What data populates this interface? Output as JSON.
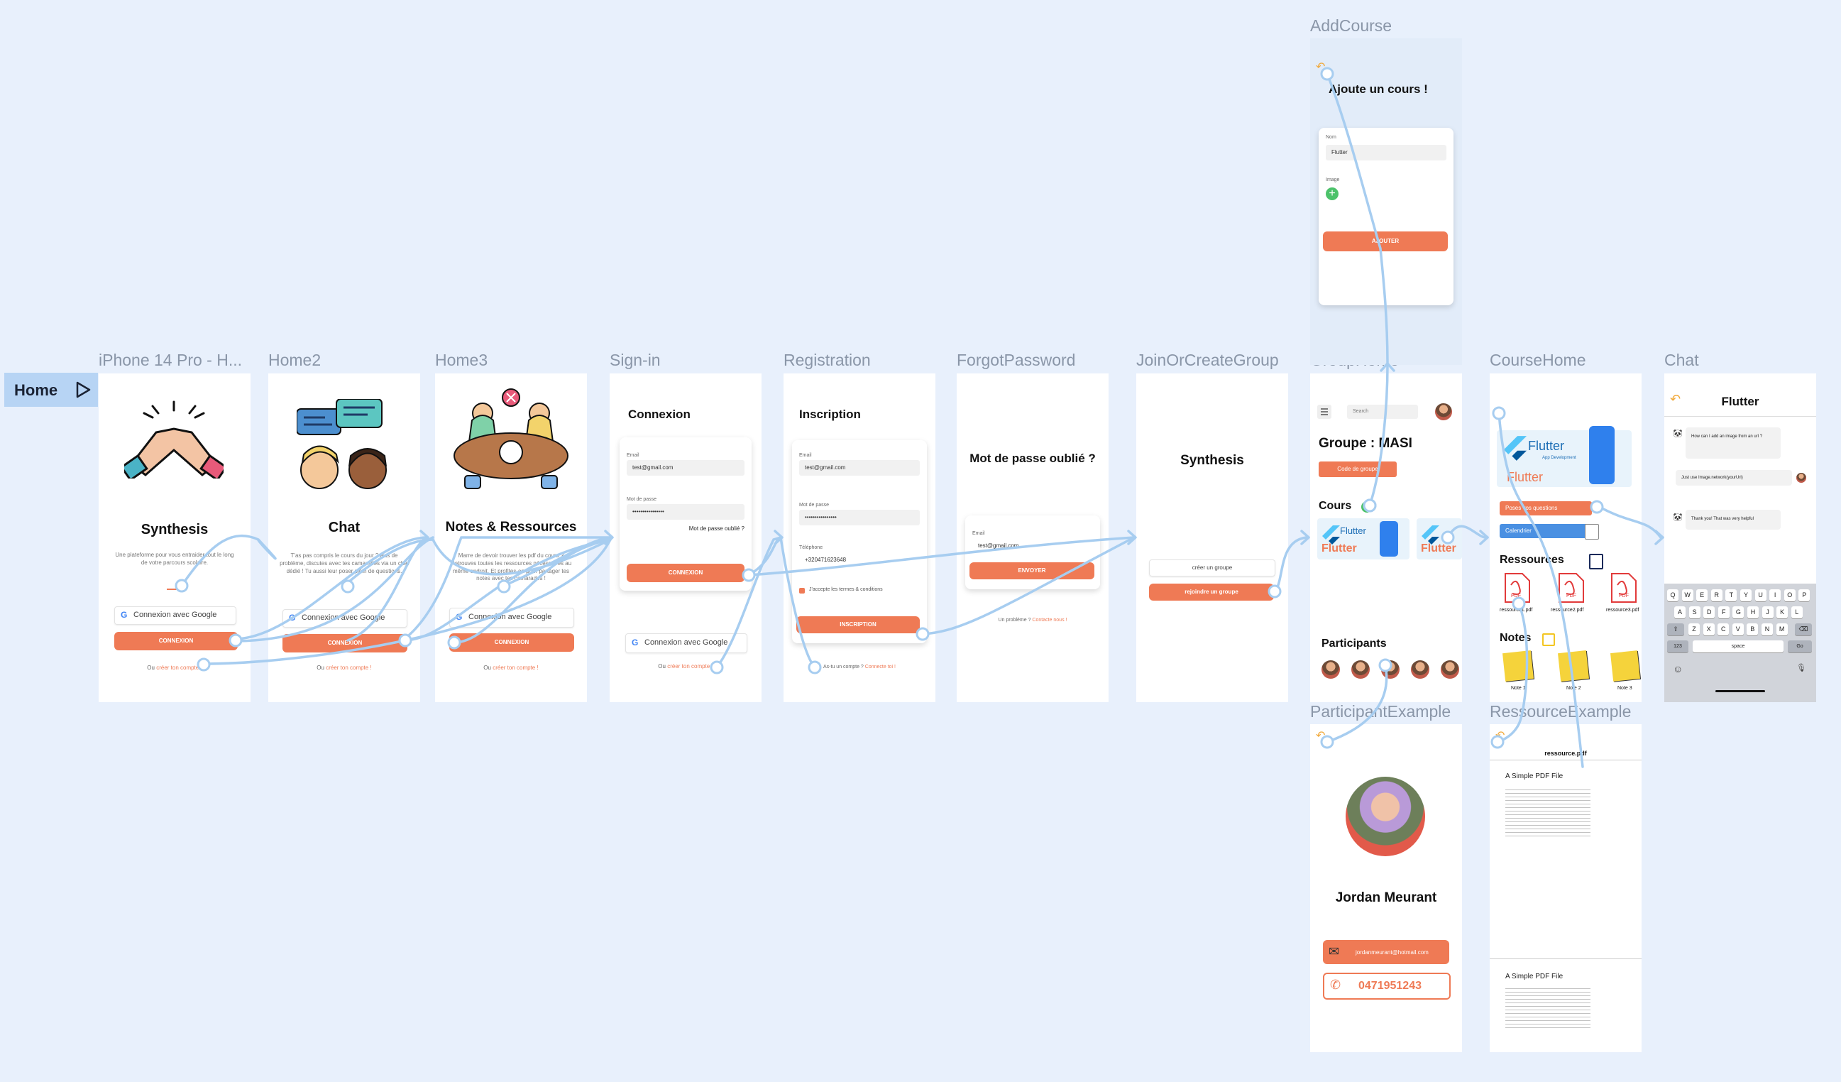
{
  "canvas_bg": "#e8f0fc",
  "accent": "#ef7a55",
  "wire_color": "#a7cdf0",
  "home_tag": {
    "label": "Home",
    "icon": "play-outline-icon"
  },
  "frames": {
    "home1": {
      "label": "iPhone 14 Pro - H...",
      "title": "Synthesis",
      "desc": "Une plateforme pour vous entraider tout le long de votre parcours scolaire.",
      "google": "Connexion avec Google",
      "connexion": "CONNEXION",
      "ou": "Ou",
      "create": "créer ton compte !"
    },
    "home2": {
      "label": "Home2",
      "title": "Chat",
      "desc": "T'as pas compris le cours du jour ? Pas de problème, discutes avec tes camarades via un chat dédié ! Tu aussi leur poser plein de questions.",
      "google": "Connexion avec Google",
      "connexion": "CONNEXION",
      "ou": "Ou",
      "create": "créer ton compte !"
    },
    "home3": {
      "label": "Home3",
      "title": "Notes & Ressources",
      "desc": "Marre de devoir trouver les pdf du cours ? Retrouves toutes les ressources nécessaires au même endroit. Et profites-en pour partager tes notes avec tes camarades !",
      "google": "Connexion avec Google",
      "connexion": "CONNEXION",
      "ou": "Ou",
      "create": "créer ton compte !"
    },
    "signin": {
      "label": "Sign-in",
      "title": "Connexion",
      "email_label": "Email",
      "email_value": "test@gmail.com",
      "pass_label": "Mot de passe",
      "pass_value": "••••••••••••••••",
      "forgot": "Mot de passe oublié ?",
      "connexion": "CONNEXION",
      "google": "Connexion avec Google",
      "ou": "Ou",
      "create": "créer ton compte !"
    },
    "registration": {
      "label": "Registration",
      "title": "Inscription",
      "email_label": "Email",
      "email_value": "test@gmail.com",
      "pass_label": "Mot de passe",
      "pass_value": "••••••••••••••••",
      "phone_label": "Téléphone",
      "phone_value": "+320471623648",
      "terms": "J'accepte les termes & conditions",
      "inscription": "INSCRIPTION",
      "have": "As-tu un compte ?",
      "connect": "Connecte toi !"
    },
    "forgot": {
      "label": "ForgotPassword",
      "title": "Mot de passe oublié ?",
      "email_label": "Email",
      "email_value": "test@gmail.com",
      "envoyer": "ENVOYER",
      "problem": "Un problème ?",
      "contact": "Contacte nous !"
    },
    "join": {
      "label": "JoinOrCreateGroup",
      "title": "Synthesis",
      "create": "créer un groupe",
      "join": "rejoindre un groupe"
    },
    "grouphome": {
      "label": "GroupHome",
      "search": "Search",
      "title": "Groupe : MASI",
      "code": "Code de groupe",
      "cours": "Cours",
      "participants": "Participants",
      "flutter": "Flutter",
      "flutter_sub": "App Development"
    },
    "coursehome": {
      "label": "CourseHome",
      "poses": "Poses vos questions",
      "calendrier": "Calendrier",
      "ressources": "Ressources",
      "notes": "Notes",
      "files": [
        "ressource1.pdf",
        "ressource2.pdf",
        "ressource3.pdf"
      ],
      "note_names": [
        "Note 1",
        "Note 2",
        "Note 3"
      ],
      "pdf": "PDF",
      "flutter": "Flutter",
      "flutter_sub": "App Development"
    },
    "chat": {
      "label": "Chat",
      "title": "Flutter",
      "msg1": "How can I add an image from an url ?",
      "msg2": "Just use Image.network(yourUrl)",
      "msg3": "Thank you! That was very helpful",
      "keys_row1": [
        "Q",
        "W",
        "E",
        "R",
        "T",
        "Y",
        "U",
        "I",
        "O",
        "P"
      ],
      "keys_row2": [
        "A",
        "S",
        "D",
        "F",
        "G",
        "H",
        "J",
        "K",
        "L"
      ],
      "keys_row3": [
        "Z",
        "X",
        "C",
        "V",
        "B",
        "N",
        "M"
      ],
      "key_123": "123",
      "key_space": "space",
      "key_go": "Go"
    },
    "addcourse": {
      "label": "AddCourse",
      "title": "Ajoute un cours !",
      "nom_label": "Nom",
      "nom_value": "Flutter",
      "image_label": "Image",
      "ajouter": "AJOUTER"
    },
    "participant": {
      "label": "ParticipantExample",
      "name": "Jordan Meurant",
      "email": "jordanmeurant@hotmail.com",
      "phone": "0471951243"
    },
    "ressource": {
      "label": "RessourceExample",
      "title": "ressource.pdf",
      "pdf_title": "A Simple PDF File",
      "pdf_title2": "A Simple PDF File"
    }
  }
}
